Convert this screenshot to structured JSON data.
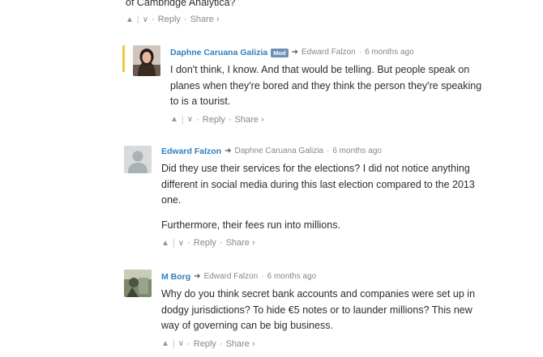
{
  "top": {
    "text_fragment": "of Cambridge Analytica?",
    "actions": {
      "up": "▲",
      "sep": "|",
      "down": "∨",
      "dot": "·",
      "reply": "Reply",
      "share": "Share ›"
    }
  },
  "comments": [
    {
      "author": "Daphne Caruana Galizia",
      "badge": "Mod",
      "reply_to": "Edward Falzon",
      "time": "6 months ago",
      "paragraphs": [
        "I don't think, I know. And that would be telling. But people speak on",
        "planes when they're bored and they think the person they're speaking",
        "to is a tourist."
      ],
      "actions": {
        "up": "▲",
        "sep": "|",
        "down": "∨",
        "dot": "·",
        "reply": "Reply",
        "share": "Share ›"
      },
      "highlight_color": "#f3c53c"
    },
    {
      "author": "Edward Falzon",
      "reply_to": "Daphne Caruana Galizia",
      "time": "6 months ago",
      "paragraphs": [
        "Did they use their services for the elections? I did not notice anything",
        "different in social media during this last election compared to the 2013",
        "one.",
        "Furthermore, their fees run into millions."
      ],
      "actions": {
        "up": "▲",
        "sep": "|",
        "down": "∨",
        "dot": "·",
        "reply": "Reply",
        "share": "Share ›"
      }
    },
    {
      "author": "M Borg",
      "reply_to": "Edward Falzon",
      "time": "6 months ago",
      "paragraphs": [
        "Why do you think secret bank accounts and companies were set up in",
        "dodgy jurisdictions? To hide €5 notes or to launder millions? This new",
        "way of governing can be big business."
      ],
      "actions": {
        "up": "▲",
        "sep": "|",
        "down": "∨",
        "dot": "·",
        "reply": "Reply",
        "share": "Share ›"
      }
    }
  ],
  "colors": {
    "author_link": "#2f7fc0",
    "meta": "#7f8a90",
    "text": "#2a2e2e",
    "mod_badge": "#6c8fb3"
  },
  "icons": {
    "reply_arrow": "➜"
  }
}
